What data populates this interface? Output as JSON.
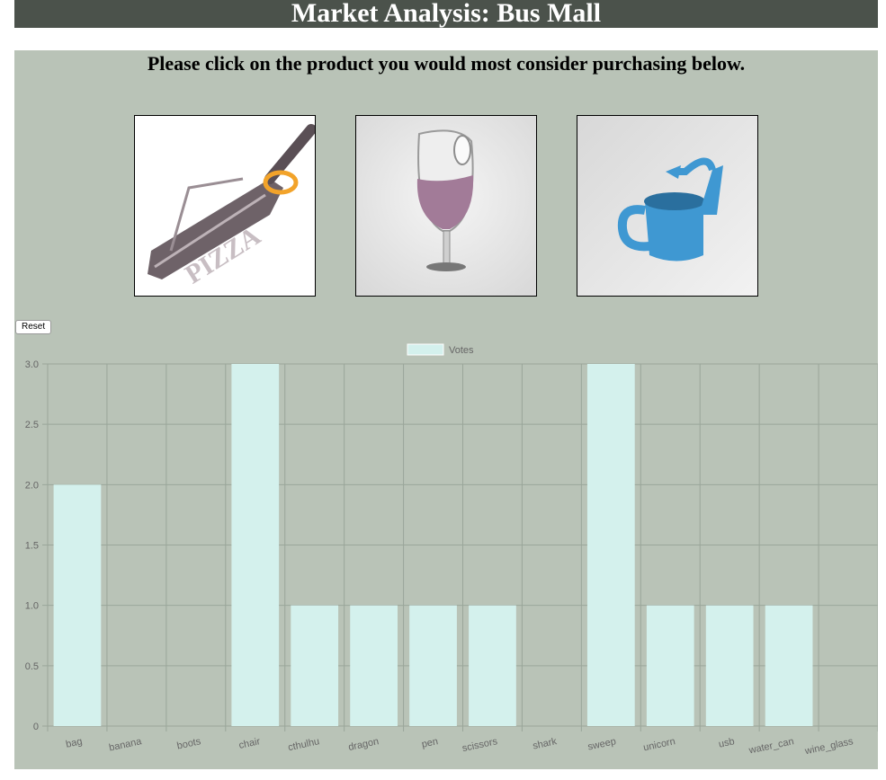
{
  "header": {
    "title": "Market Analysis: Bus Mall"
  },
  "instructions": "Please click on the product you would most consider purchasing below.",
  "products": [
    {
      "name": "scissors",
      "icon": "pizza-scissors-icon"
    },
    {
      "name": "wine_glass",
      "icon": "wine-glass-icon"
    },
    {
      "name": "water_can",
      "icon": "watering-can-icon"
    }
  ],
  "reset_label": "Reset",
  "colors": {
    "bar": "#d4f1ed",
    "grid": "#9aa69a",
    "header": "#4b524b",
    "panel": "#b9c3b7"
  },
  "chart_data": {
    "type": "bar",
    "categories": [
      "bag",
      "banana",
      "boots",
      "chair",
      "cthulhu",
      "dragon",
      "pen",
      "scissors",
      "shark",
      "sweep",
      "unicorn",
      "usb",
      "water_can",
      "wine_glass"
    ],
    "series": [
      {
        "name": "Votes",
        "values": [
          2,
          0,
          0,
          3,
          1,
          1,
          1,
          1,
          0,
          3,
          1,
          1,
          1,
          0
        ]
      }
    ],
    "yticks": [
      "0",
      "0.5",
      "1.0",
      "1.5",
      "2.0",
      "2.5",
      "3.0"
    ],
    "ylim": [
      0,
      3
    ],
    "grid": true,
    "legend": "top-center"
  }
}
